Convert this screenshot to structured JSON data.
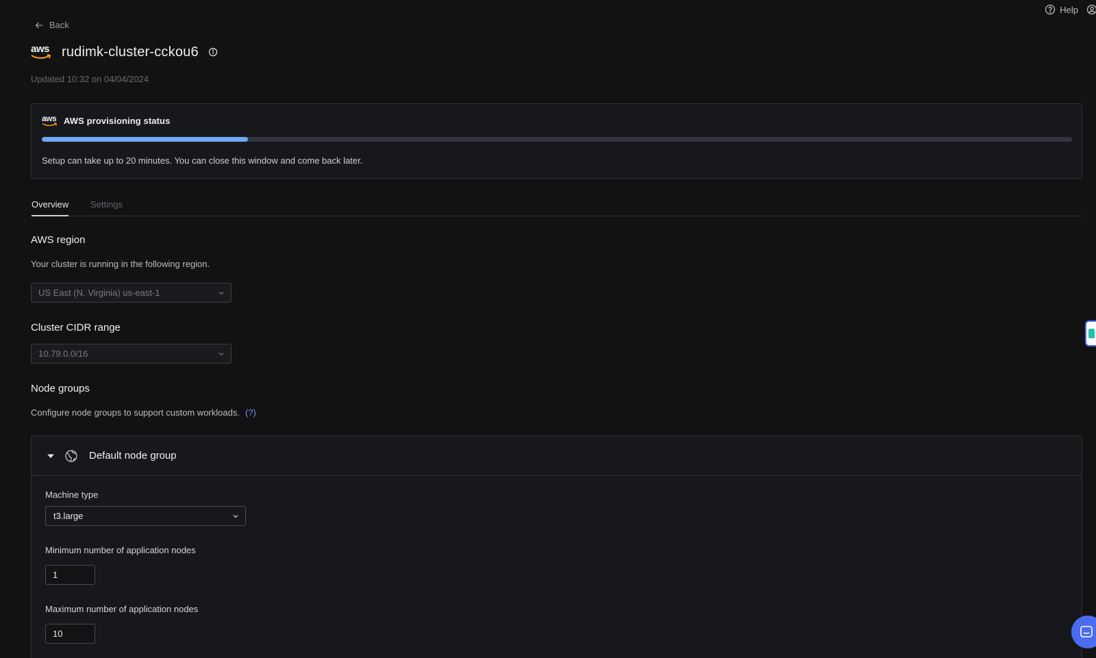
{
  "topbar": {
    "help_label": "Help",
    "help_icon": "help-circle-icon",
    "account_icon": "user-circle-icon"
  },
  "nav": {
    "back_label": "Back",
    "back_icon": "arrow-left-icon"
  },
  "header": {
    "provider_logo_text": "aws",
    "title": "rudimk-cluster-cckou6",
    "info_icon": "info-icon",
    "updated": "Updated 10:32 on 04/04/2024"
  },
  "provisioning": {
    "logo_text": "aws",
    "title": "AWS provisioning status",
    "progress_fraction": 0.2,
    "progress_color": "#6fa9f5",
    "note": "Setup can take up to 20 minutes. You can close this window and come back later."
  },
  "tabs": [
    {
      "label": "Overview",
      "active": true
    },
    {
      "label": "Settings",
      "active": false
    }
  ],
  "region": {
    "title": "AWS region",
    "description": "Your cluster is running in the following region.",
    "selected": "US East (N. Virginia) us-east-1"
  },
  "cidr": {
    "title": "Cluster CIDR range",
    "selected": "10.79.0.0/16"
  },
  "node_groups": {
    "title": "Node groups",
    "description": "Configure node groups to support custom workloads.",
    "help_link": "(?)",
    "group": {
      "name": "Default node group",
      "machine_type_label": "Machine type",
      "machine_type": "t3.large",
      "min_label": "Minimum number of application nodes",
      "min_value": "1",
      "max_label": "Maximum number of application nodes",
      "max_value": "10"
    }
  },
  "colors": {
    "background": "#121213",
    "accent": "#4b6cf0",
    "link": "#7f8ff5"
  }
}
